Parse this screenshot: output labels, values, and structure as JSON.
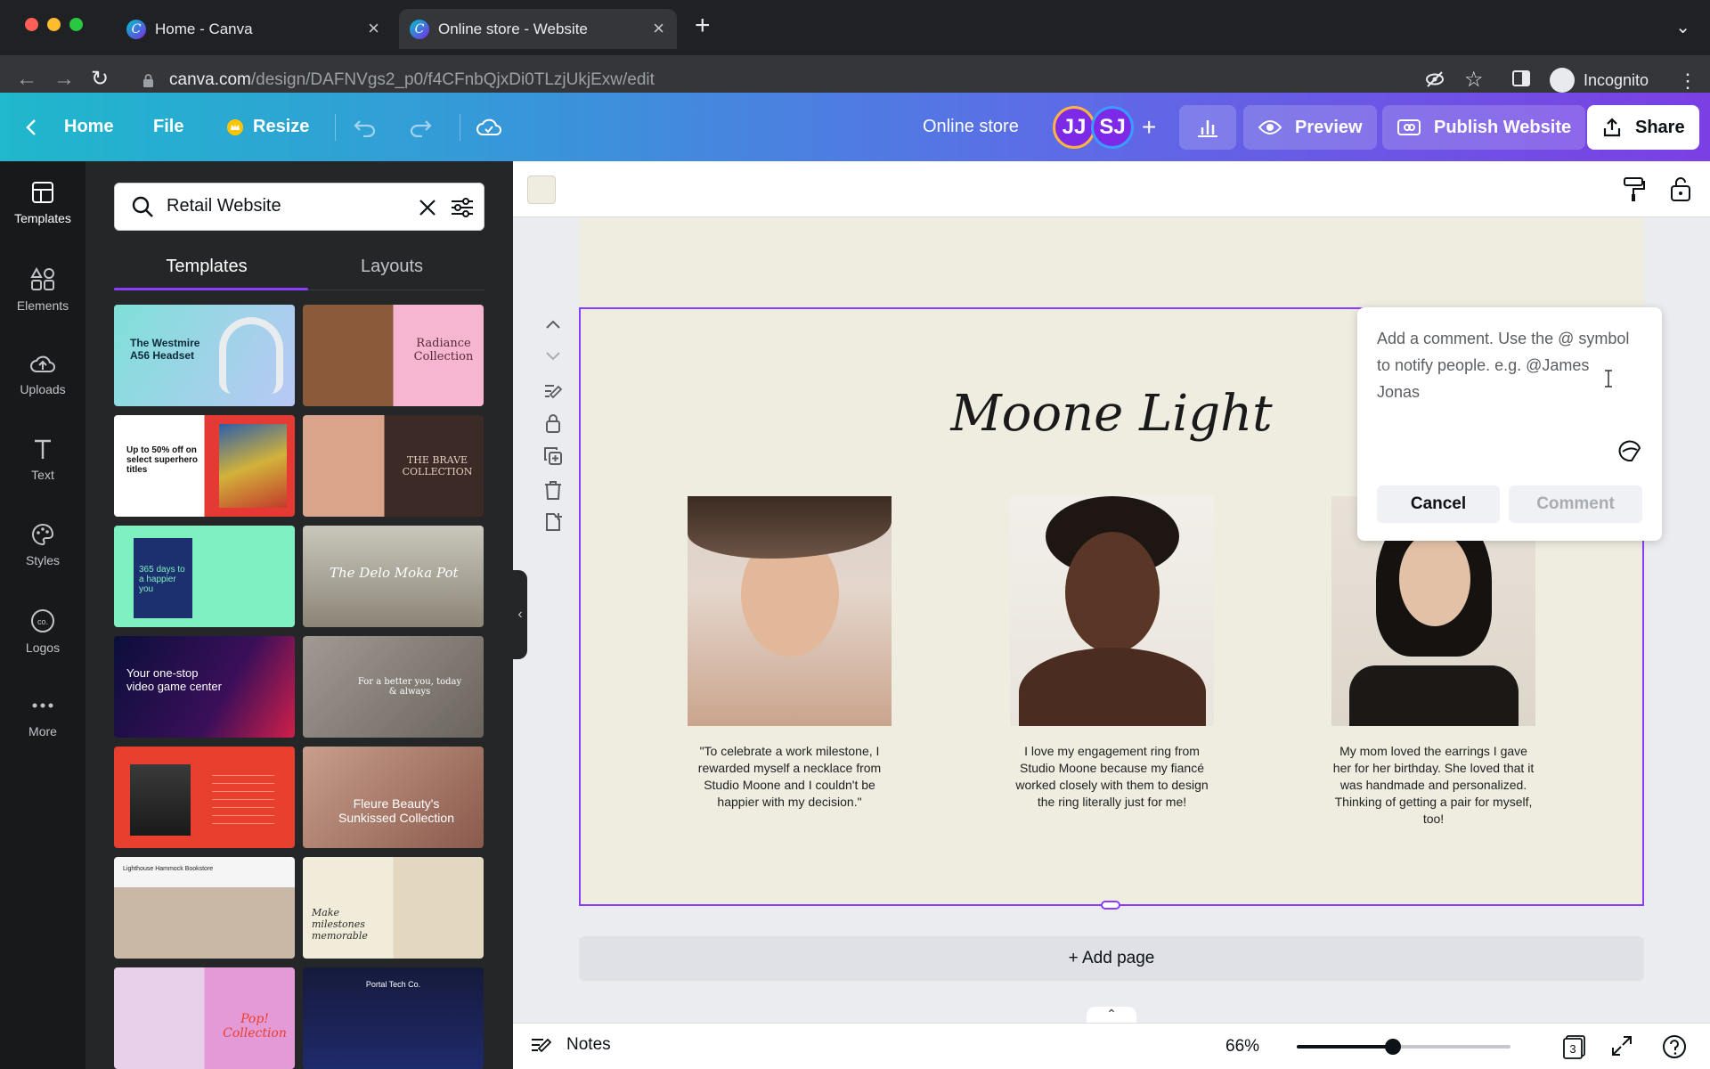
{
  "browser": {
    "tabs": [
      {
        "title": "Home - Canva",
        "active": false
      },
      {
        "title": "Online store - Website",
        "active": true
      }
    ],
    "url_host": "canva.com",
    "url_path": "/design/DAFNVgs2_p0/f4CFnbQjxDi0TLzjUkjExw/edit",
    "profile_label": "Incognito"
  },
  "header": {
    "home_label": "Home",
    "file_label": "File",
    "resize_label": "Resize",
    "doc_title": "Online store",
    "avatars": [
      "JJ",
      "SJ"
    ],
    "preview_label": "Preview",
    "publish_label": "Publish Website",
    "share_label": "Share"
  },
  "rail": [
    {
      "label": "Templates",
      "icon": "templates-icon"
    },
    {
      "label": "Elements",
      "icon": "elements-icon"
    },
    {
      "label": "Uploads",
      "icon": "uploads-icon"
    },
    {
      "label": "Text",
      "icon": "text-icon"
    },
    {
      "label": "Styles",
      "icon": "styles-icon"
    },
    {
      "label": "Logos",
      "icon": "logos-icon"
    },
    {
      "label": "More",
      "icon": "more-icon"
    }
  ],
  "panel": {
    "search_value": "Retail Website",
    "tabs": [
      "Templates",
      "Layouts"
    ],
    "thumbnails": [
      {
        "text": "The Westmire A56 Headset"
      },
      {
        "text": "Radiance Collection"
      },
      {
        "text": "Up to 50% off on select superhero titles"
      },
      {
        "text": "THE BRAVE COLLECTION"
      },
      {
        "text": "365 days to a happier you"
      },
      {
        "text": "The Delo Moka Pot"
      },
      {
        "text": "Your one-stop video game center"
      },
      {
        "text": "For a better you, today & always"
      },
      {
        "text": ""
      },
      {
        "text": "Fleure Beauty's Sunkissed Collection"
      },
      {
        "text": "Lighthouse Hammock Bookstore"
      },
      {
        "text": "Make milestones memorable"
      },
      {
        "text": "Pop! Collection"
      },
      {
        "text": "Portal Tech Co."
      }
    ]
  },
  "page": {
    "title": "Moone Light",
    "quotes": [
      "\"To celebrate a work milestone, I rewarded myself a necklace from Studio Moone and I couldn't be happier with my decision.\"",
      "I love my engagement ring from Studio Moone because my fiancé worked closely with them to design the ring literally just for me!",
      "My mom loved the earrings I gave her for her birthday. She loved that it was handmade and personalized. Thinking of getting a pair for myself, too!"
    ]
  },
  "comment": {
    "placeholder": "Add a comment. Use the @ symbol to notify people. e.g. @James Jonas",
    "cancel_label": "Cancel",
    "comment_label": "Comment"
  },
  "add_page_label": "+ Add page",
  "bottom": {
    "notes_label": "Notes",
    "zoom": "66%",
    "zoom_fraction": 0.45,
    "page_count": "3"
  },
  "colors": {
    "brand_purple": "#8b3dff",
    "page_bg": "#efece0",
    "panel_bg": "#252627",
    "rail_bg": "#18191b"
  }
}
